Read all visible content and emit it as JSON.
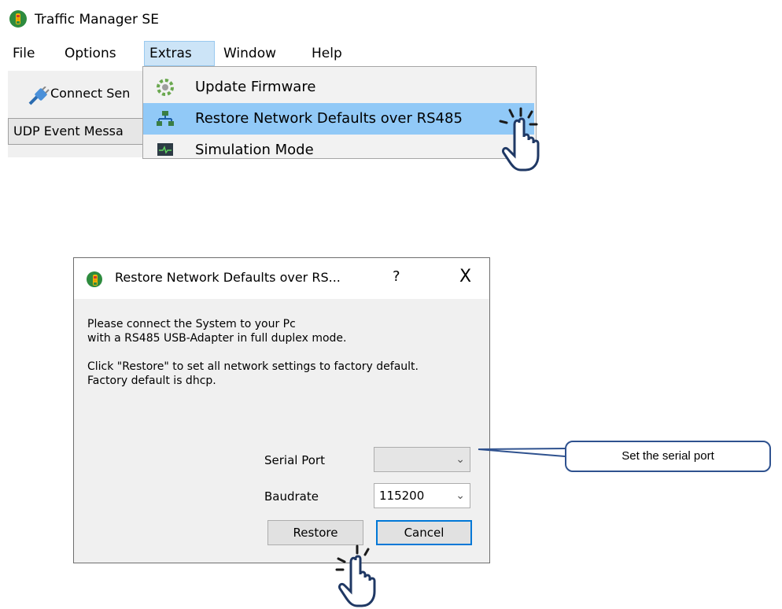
{
  "app": {
    "title": "Traffic Manager SE",
    "icon": "traffic-light-icon"
  },
  "menubar": {
    "items": [
      "File",
      "Options",
      "Extras",
      "Window",
      "Help"
    ],
    "active": "Extras"
  },
  "toolbar": {
    "connect_label": "Connect Sen",
    "tab_label": "UDP Event Messa"
  },
  "extras_menu": {
    "items": [
      {
        "label": "Update Firmware",
        "icon": "gear-firmware-icon"
      },
      {
        "label": "Restore Network Defaults over RS485",
        "icon": "network-icon",
        "highlighted": true
      },
      {
        "label": "Simulation Mode",
        "icon": "monitor-icon"
      }
    ],
    "highlight_color": "#91c9f7"
  },
  "dialog": {
    "title": "Restore Network Defaults over RS...",
    "help": "?",
    "close": "X",
    "text_line1": "Please connect the System to your Pc",
    "text_line2": "with a RS485 USB-Adapter in full duplex mode.",
    "text_line3": "Click \"Restore\" to set all network settings to factory default.",
    "text_line4": "Factory default is dhcp.",
    "serial_port_label": "Serial Port",
    "serial_port_value": "",
    "baudrate_label": "Baudrate",
    "baudrate_value": "115200",
    "restore_label": "Restore",
    "cancel_label": "Cancel"
  },
  "callout": {
    "text": "Set the serial port",
    "border_color": "#2f528f"
  },
  "accent_color": "#0078d7"
}
